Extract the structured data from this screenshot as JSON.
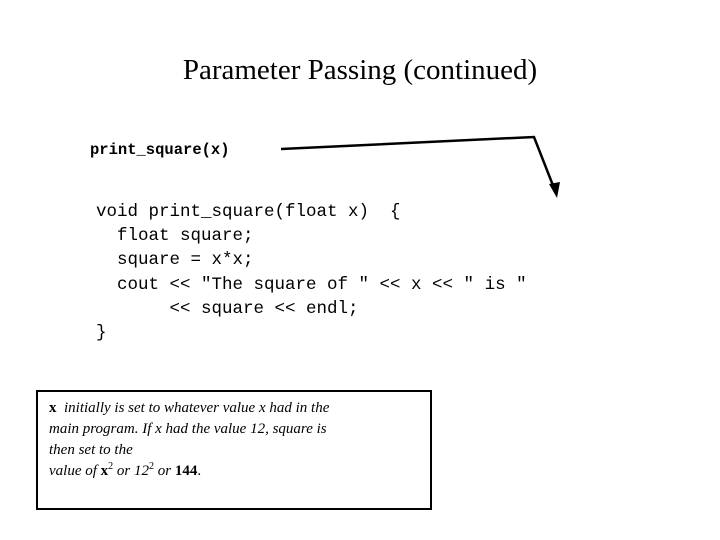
{
  "slide": {
    "title": "Parameter Passing (continued)",
    "call_statement": "print_square(x)",
    "code_lines": [
      "void print_square(float x)  {",
      "  float square;",
      "  square = x*x;",
      "  cout << \"The square of \" << x << \" is \"",
      "       << square << endl;",
      "}"
    ],
    "arrow_icon": "arrow-from-call-to-function",
    "note": {
      "var": "x",
      "line1_rest": "initially is set to whatever value x had in the",
      "line2": "main program. If x had the value 12, square is",
      "line3": "then set to the",
      "line4_prefix": "value of ",
      "line4_var": "x",
      "line4_exp1": "2",
      "line4_or1": " or 12",
      "line4_exp2": "2",
      "line4_or2": " or ",
      "line4_result": "144",
      "line4_end": "."
    }
  }
}
